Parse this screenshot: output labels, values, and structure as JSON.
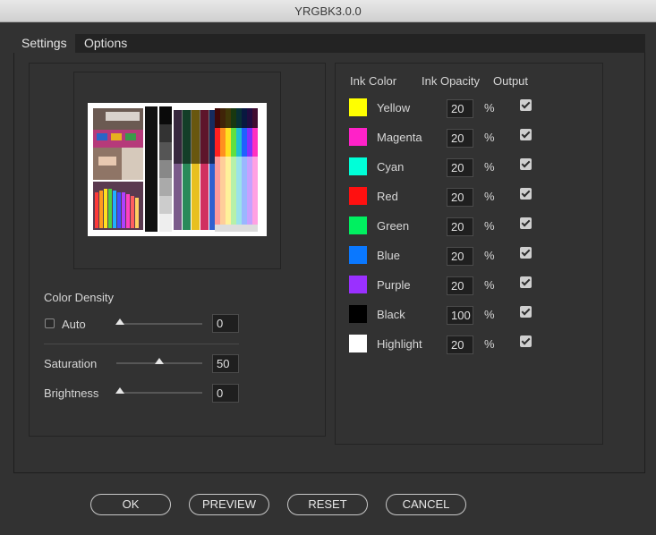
{
  "window": {
    "title": "YRGBK3.0.0"
  },
  "tabs": [
    {
      "label": "Settings",
      "active": true
    },
    {
      "label": "Options",
      "active": false
    }
  ],
  "color_density": {
    "heading": "Color Density",
    "auto_label": "Auto",
    "auto_checked": false,
    "density_value": "0",
    "density_level": 0.0,
    "saturation_label": "Saturation",
    "saturation_value": "50",
    "saturation_level": 0.5,
    "brightness_label": "Brightness",
    "brightness_value": "0",
    "brightness_level": 0.0
  },
  "inks": {
    "headers": {
      "color": "Ink Color",
      "opacity": "Ink Opacity",
      "output": "Output"
    },
    "unit": "%",
    "rows": [
      {
        "name": "Yellow",
        "swatch": "#ffff00",
        "opacity": "20",
        "output": true
      },
      {
        "name": "Magenta",
        "swatch": "#ff22c8",
        "opacity": "20",
        "output": true
      },
      {
        "name": "Cyan",
        "swatch": "#00ffd8",
        "opacity": "20",
        "output": true
      },
      {
        "name": "Red",
        "swatch": "#ff1010",
        "opacity": "20",
        "output": true
      },
      {
        "name": "Green",
        "swatch": "#00f060",
        "opacity": "20",
        "output": true
      },
      {
        "name": "Blue",
        "swatch": "#0a78ff",
        "opacity": "20",
        "output": true
      },
      {
        "name": "Purple",
        "swatch": "#9a30ff",
        "opacity": "20",
        "output": true
      },
      {
        "name": "Black",
        "swatch": "#000000",
        "opacity": "100",
        "output": true
      },
      {
        "name": "Highlight",
        "swatch": "#ffffff",
        "opacity": "20",
        "output": true
      }
    ]
  },
  "buttons": {
    "ok": "OK",
    "preview": "PREVIEW",
    "reset": "RESET",
    "cancel": "CANCEL"
  }
}
